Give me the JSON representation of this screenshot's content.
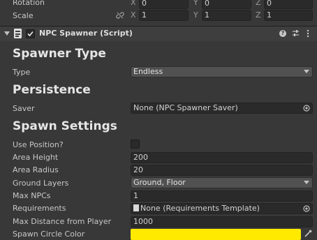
{
  "transform": {
    "rotation_label": "Rotation",
    "scale_label": "Scale",
    "x_label": "X",
    "y_label": "Y",
    "z_label": "Z",
    "rotation": {
      "x": "0",
      "y": "0",
      "z": "0"
    },
    "scale": {
      "x": "1",
      "y": "1",
      "z": "1"
    }
  },
  "component": {
    "title": "NPC Spawner (Script)",
    "enabled": true
  },
  "sections": {
    "spawner_type": "Spawner Type",
    "persistence": "Persistence",
    "spawn_settings": "Spawn Settings"
  },
  "fields": {
    "type_label": "Type",
    "type_value": "Endless",
    "saver_label": "Saver",
    "saver_value": "None (NPC Spawner Saver)",
    "use_position_label": "Use Position?",
    "use_position_value": false,
    "area_height_label": "Area Height",
    "area_height_value": "200",
    "area_radius_label": "Area Radius",
    "area_radius_value": "20",
    "ground_layers_label": "Ground Layers",
    "ground_layers_value": "Ground, Floor",
    "max_npcs_label": "Max NPCs",
    "max_npcs_value": "1",
    "requirements_label": "Requirements",
    "requirements_value": "None (Requirements Template)",
    "max_distance_label": "Max Distance from Player",
    "max_distance_value": "1000",
    "spawn_circle_color_label": "Spawn Circle Color",
    "spawn_circle_color_value": "#ffea00"
  },
  "colors": {
    "background": "#383838",
    "header": "#3e3e3e",
    "field": "#2a2a2a"
  }
}
